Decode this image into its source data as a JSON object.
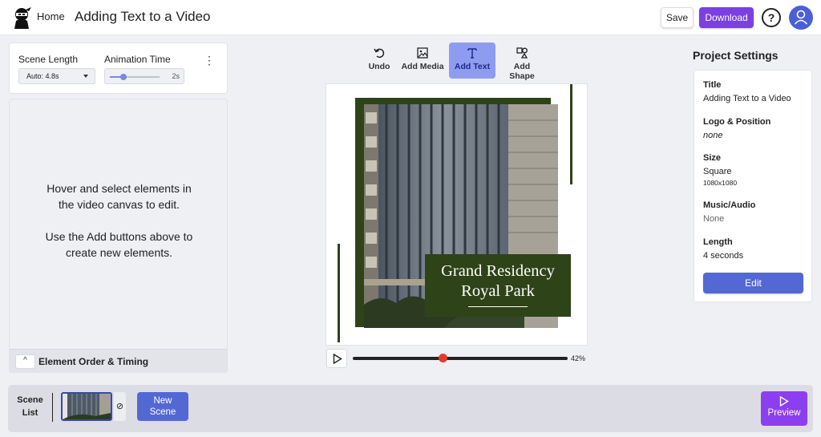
{
  "header": {
    "home_label": "Home",
    "title": "Adding Text to a Video",
    "save_label": "Save",
    "download_label": "Download",
    "help_label": "?",
    "accent": "#7b3fe4"
  },
  "scene_settings": {
    "scene_length_label": "Scene Length",
    "scene_length_value": "Auto: 4.8s",
    "animation_time_label": "Animation Time",
    "animation_time_value": "2s",
    "animation_slider_fraction": 0.28
  },
  "hint": {
    "line1": "Hover and select elements in the video canvas to edit.",
    "line2": "Use the Add buttons above to create new elements."
  },
  "element_order": {
    "label": "Element Order & Timing",
    "toggle": "^"
  },
  "toolbar": {
    "undo": "Undo",
    "add_media": "Add Media",
    "add_text": "Add Text",
    "add_shape": "Add Shape",
    "active_tool": "Add Text"
  },
  "canvas": {
    "caption_line1": "Grand Residency",
    "caption_line2": "Royal Park",
    "frame_color": "#2e4318"
  },
  "playback": {
    "progress_label": "42%",
    "progress_fraction": 0.42
  },
  "project_settings": {
    "heading": "Project Settings",
    "title_label": "Title",
    "title_value": "Adding Text to a Video",
    "logo_label": "Logo & Position",
    "logo_value": "none",
    "size_label": "Size",
    "size_value": "Square",
    "size_dims": "1080x1080",
    "music_label": "Music/Audio",
    "music_value": "None",
    "length_label": "Length",
    "length_value": "4 seconds",
    "edit_label": "Edit"
  },
  "scene_list": {
    "label_line1": "Scene",
    "label_line2": "List",
    "new_scene_line1": "New",
    "new_scene_line2": "Scene",
    "preview_label": "Preview"
  }
}
